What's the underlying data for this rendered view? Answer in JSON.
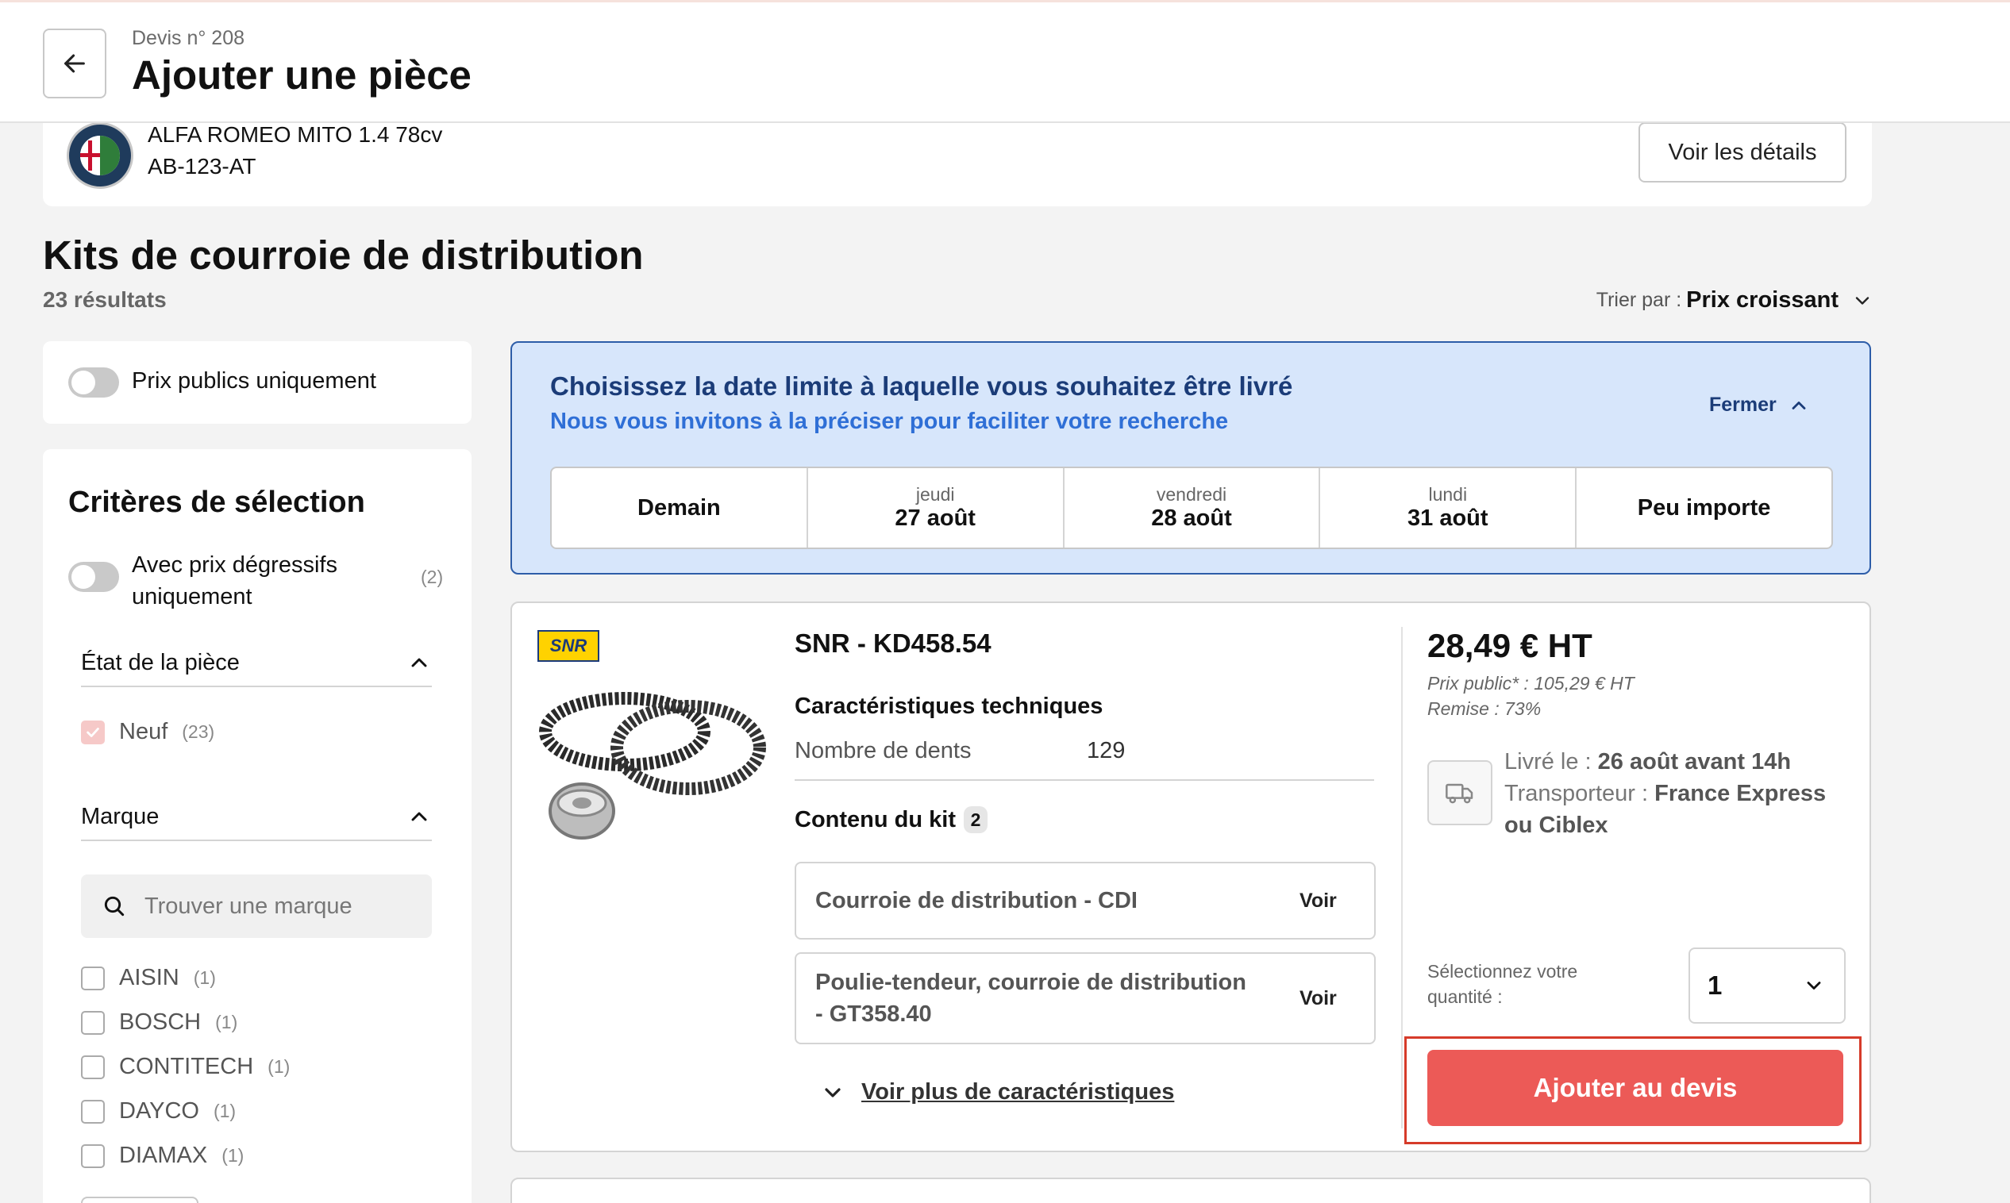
{
  "header": {
    "subtitle": "Devis n° 208",
    "title": "Ajouter une pièce"
  },
  "vehicle": {
    "name": "ALFA ROMEO MITO 1.4 78cv",
    "plate": "AB-123-AT",
    "details_button": "Voir les détails"
  },
  "page": {
    "title": "Kits de courroie de distribution",
    "results": "23 résultats",
    "sort_label": "Trier par :",
    "sort_value": "Prix croissant"
  },
  "sidebar": {
    "public_prices_label": "Prix publics uniquement",
    "criteria_title": "Critères de sélection",
    "degressive_label_1": "Avec prix dégressifs",
    "degressive_label_2": "uniquement",
    "degressive_count": "(2)",
    "state_section": "État de la pièce",
    "state_new_label": "Neuf",
    "state_new_count": "(23)",
    "brand_section": "Marque",
    "brand_search_placeholder": "Trouver une marque",
    "brands": [
      {
        "label": "AISIN",
        "count": "(1)"
      },
      {
        "label": "BOSCH",
        "count": "(1)"
      },
      {
        "label": "CONTITECH",
        "count": "(1)"
      },
      {
        "label": "DAYCO",
        "count": "(1)"
      },
      {
        "label": "DIAMAX",
        "count": "(1)"
      }
    ]
  },
  "delivery": {
    "title": "Choisissez la date limite à laquelle vous souhaitez être livré",
    "subtitle": "Nous vous invitons à la préciser pour faciliter votre recherche",
    "close_label": "Fermer",
    "dates": [
      {
        "day": "",
        "date": "Demain"
      },
      {
        "day": "jeudi",
        "date": "27 août"
      },
      {
        "day": "vendredi",
        "date": "28 août"
      },
      {
        "day": "lundi",
        "date": "31 août"
      },
      {
        "day": "",
        "date": "Peu importe"
      }
    ]
  },
  "product": {
    "brand_logo": "SNR",
    "name": "SNR - KD458.54",
    "specs_title": "Caractéristiques techniques",
    "spec_key": "Nombre de dents",
    "spec_value": "129",
    "kit_title": "Contenu du kit",
    "kit_count": "2",
    "kit_items": [
      {
        "name": "Courroie de distribution - CDI",
        "action": "Voir"
      },
      {
        "name": "Poulie-tendeur, courroie de distribution - GT358.40",
        "action": "Voir"
      }
    ],
    "more_link": "Voir plus de caractéristiques",
    "price": "28,49 € HT",
    "public_price": "Prix public* : 105,29 € HT",
    "discount": "Remise : 73%",
    "delivery_label": "Livré le :",
    "delivery_value": "26 août avant 14h",
    "carrier_label": "Transporteur :",
    "carrier_value": "France Express ou Ciblex",
    "quantity_label": "Sélectionnez votre quantité :",
    "quantity_value": "1",
    "add_button": "Ajouter au devis"
  },
  "colors": {
    "accent_red": "#ec5a57",
    "highlight_border": "#d63b2a",
    "delivery_bg": "#d7e6fb",
    "delivery_border": "#2d5da8"
  },
  "icons": [
    "arrow-left-icon",
    "chevron-down-icon",
    "chevron-up-icon",
    "search-icon",
    "truck-icon",
    "check-icon"
  ]
}
